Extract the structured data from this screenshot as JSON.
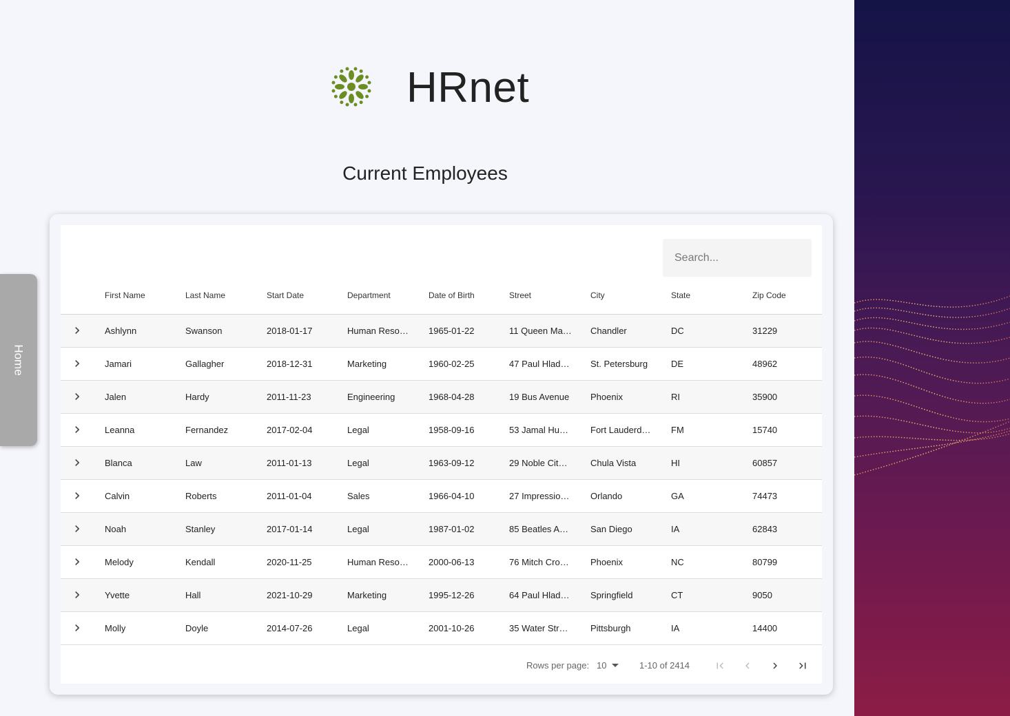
{
  "header": {
    "brand": "HRnet",
    "subtitle": "Current Employees",
    "logo_icon": "leaf-wreath-logo",
    "logo_color": "#6b8e23"
  },
  "nav": {
    "home_label": "Home"
  },
  "search": {
    "placeholder": "Search...",
    "value": ""
  },
  "table": {
    "columns": [
      "First Name",
      "Last Name",
      "Start Date",
      "Department",
      "Date of Birth",
      "Street",
      "City",
      "State",
      "Zip Code"
    ],
    "rows": [
      [
        "Ashlynn",
        "Swanson",
        "2018-01-17",
        "Human Reso…",
        "1965-01-22",
        "11 Queen Ma…",
        "Chandler",
        "DC",
        "31229"
      ],
      [
        "Jamari",
        "Gallagher",
        "2018-12-31",
        "Marketing",
        "1960-02-25",
        "47 Paul Hlad…",
        "St. Petersburg",
        "DE",
        "48962"
      ],
      [
        "Jalen",
        "Hardy",
        "2011-11-23",
        "Engineering",
        "1968-04-28",
        "19 Bus Avenue",
        "Phoenix",
        "RI",
        "35900"
      ],
      [
        "Leanna",
        "Fernandez",
        "2017-02-04",
        "Legal",
        "1958-09-16",
        "53 Jamal Hu…",
        "Fort Lauderd…",
        "FM",
        "15740"
      ],
      [
        "Blanca",
        "Law",
        "2011-01-13",
        "Legal",
        "1963-09-12",
        "29 Noble Cit…",
        "Chula Vista",
        "HI",
        "60857"
      ],
      [
        "Calvin",
        "Roberts",
        "2011-01-04",
        "Sales",
        "1966-04-10",
        "27 Impressio…",
        "Orlando",
        "GA",
        "74473"
      ],
      [
        "Noah",
        "Stanley",
        "2017-01-14",
        "Legal",
        "1987-01-02",
        "85 Beatles A…",
        "San Diego",
        "IA",
        "62843"
      ],
      [
        "Melody",
        "Kendall",
        "2020-11-25",
        "Human Reso…",
        "2000-06-13",
        "76 Mitch Cro…",
        "Phoenix",
        "NC",
        "80799"
      ],
      [
        "Yvette",
        "Hall",
        "2021-10-29",
        "Marketing",
        "1995-12-26",
        "64 Paul Hlad…",
        "Springfield",
        "CT",
        "9050"
      ],
      [
        "Molly",
        "Doyle",
        "2014-07-26",
        "Legal",
        "2001-10-26",
        "35 Water Str…",
        "Pittsburgh",
        "IA",
        "14400"
      ]
    ]
  },
  "pagination": {
    "rows_per_page_label": "Rows per page:",
    "rows_per_page_value": "10",
    "range_text": "1-10 of 2414",
    "icons": [
      "first-page-icon",
      "previous-page-icon",
      "next-page-icon",
      "last-page-icon"
    ]
  },
  "colors": {
    "background": "#f5f6fb",
    "home_tab": "#a9a9a9",
    "panel_top": "#141447",
    "panel_bottom": "#8c1c45",
    "wave": "#f5b06a"
  }
}
